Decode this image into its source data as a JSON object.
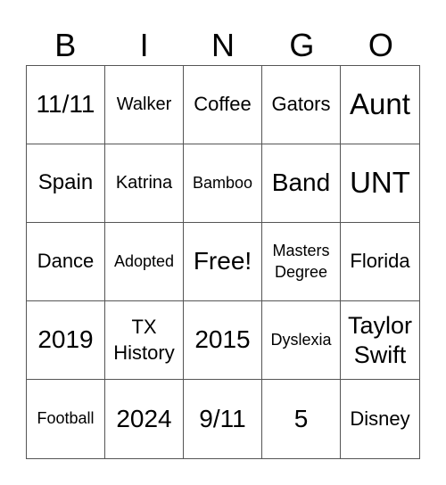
{
  "header": [
    "B",
    "I",
    "N",
    "G",
    "O"
  ],
  "cells": [
    [
      "11/11",
      "Walker",
      "Coffee",
      "Gators",
      "Aunt"
    ],
    [
      "Spain",
      "Katrina",
      "Bamboo",
      "Band",
      "UNT"
    ],
    [
      "Dance",
      "Adopted",
      "Free!",
      "Masters Degree",
      "Florida"
    ],
    [
      "2019",
      "TX History",
      "2015",
      "Dyslexia",
      "Taylor Swift"
    ],
    [
      "Football",
      "2024",
      "9/11",
      "5",
      "Disney"
    ]
  ]
}
